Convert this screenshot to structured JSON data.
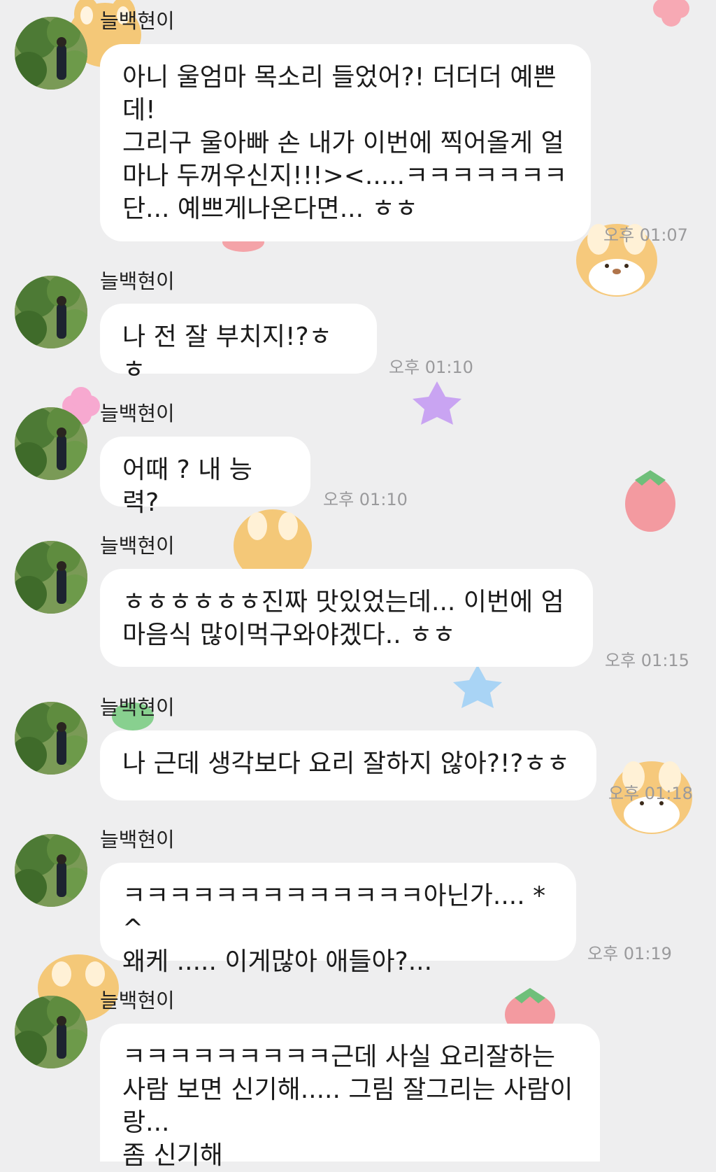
{
  "chat": {
    "messages": [
      {
        "sender": "늘백현이",
        "text": "아니 울엄마 목소리 들었어?! 더더더 예쁜\n데!\n그리구 울아빠 손 내가 이번에 찍어올게 얼\n마나 두꺼우신지!!!><.....ㅋㅋㅋㅋㅋㅋㅋ\n단... 예쁘게나온다면... ㅎㅎ",
        "time": "오후 01:07"
      },
      {
        "sender": "늘백현이",
        "text": "나 전 잘 부치지!?ㅎㅎ",
        "time": "오후 01:10"
      },
      {
        "sender": "늘백현이",
        "text": "어때 ? 내 능력?",
        "time": "오후 01:10"
      },
      {
        "sender": "늘백현이",
        "text": "ㅎㅎㅎㅎㅎㅎ진짜 맛있었는데... 이번에 엄\n마음식 많이먹구와야겠다.. ㅎㅎ",
        "time": "오후 01:15"
      },
      {
        "sender": "늘백현이",
        "text": "나 근데 생각보다 요리 잘하지 않아?!?ㅎㅎ",
        "time": "오후 01:18"
      },
      {
        "sender": "늘백현이",
        "text": "ㅋㅋㅋㅋㅋㅋㅋㅋㅋㅋㅋㅋㅋ아닌가.... *^\n왜케 ..... 이게많아 애들아?...",
        "time": "오후 01:19"
      },
      {
        "sender": "늘백현이",
        "text": "ㅋㅋㅋㅋㅋㅋㅋㅋㅋ근데 사실 요리잘하는\n사람 보면 신기해..... 그림 잘그리는 사람이\n랑...\n좀 신기해",
        "time": ""
      }
    ]
  },
  "colors": {
    "background": "#eeeeef",
    "bubble": "#ffffff",
    "time_text": "#9a9a9c",
    "sender_text": "#222222"
  },
  "icons": {
    "wallpaper": [
      "hamster-sticker",
      "star-sticker",
      "strawberry-sticker",
      "flower-sticker"
    ]
  }
}
